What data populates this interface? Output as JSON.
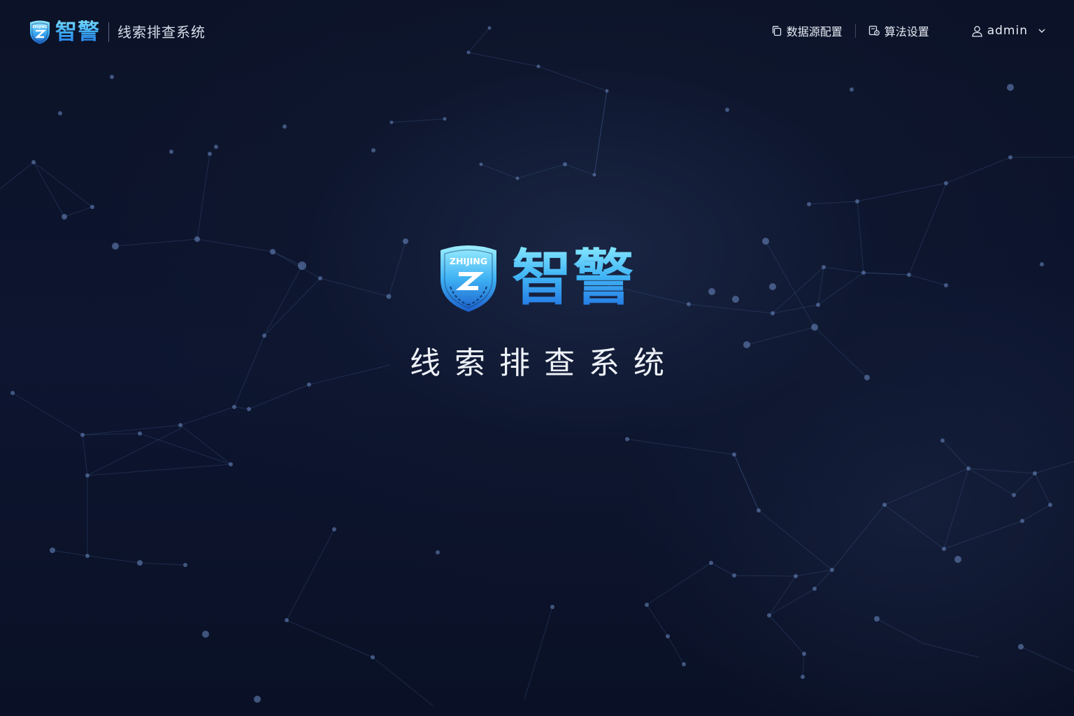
{
  "header": {
    "brand": {
      "shield_text": "ZHIJING",
      "name": "智警",
      "subtitle": "线索排查系统"
    },
    "nav": [
      {
        "label": "数据源配置",
        "icon": "data-source-icon"
      },
      {
        "label": "算法设置",
        "icon": "algorithm-settings-icon"
      }
    ],
    "user": {
      "name": "admin",
      "icon": "user-icon",
      "dropdown_icon": "chevron-down-icon"
    }
  },
  "hero": {
    "shield_text": "ZHIJING",
    "brand_name": "智警",
    "title": "线索排查系统"
  },
  "colors": {
    "background": "#0b1226",
    "brand_gradient_top": "#8cecff",
    "brand_gradient_bottom": "#1d6ee0",
    "text_primary": "#e8edf5"
  }
}
